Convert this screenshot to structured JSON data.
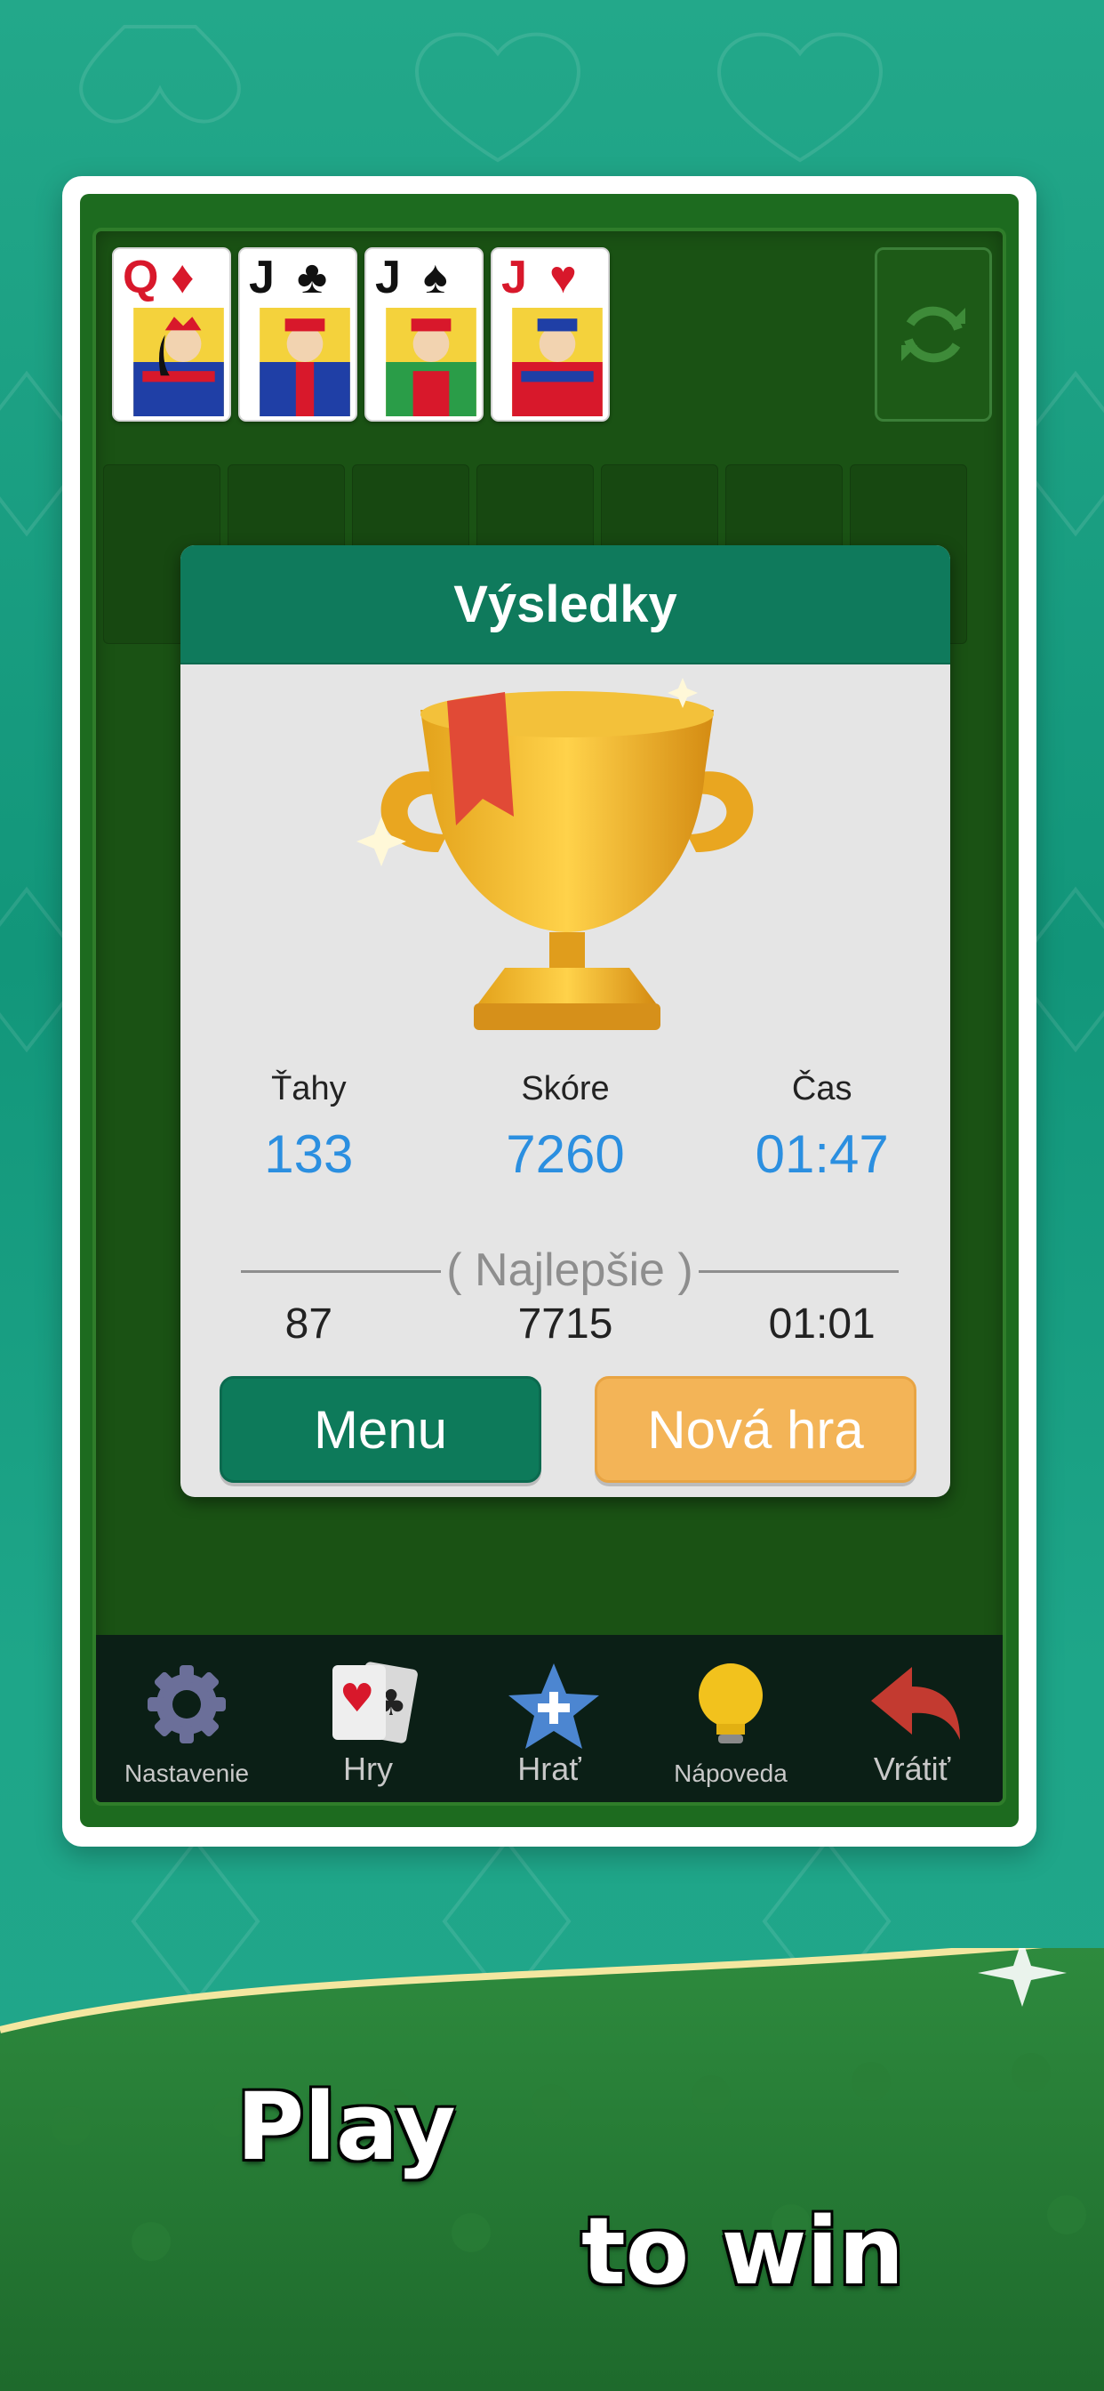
{
  "foundation": {
    "cards": [
      {
        "rank": "Q",
        "suit": "♦",
        "color": "red"
      },
      {
        "rank": "J",
        "suit": "♣",
        "color": "black"
      },
      {
        "rank": "J",
        "suit": "♠",
        "color": "black"
      },
      {
        "rank": "J",
        "suit": "♥",
        "color": "red"
      }
    ]
  },
  "refresh_icon": "refresh-icon",
  "dialog": {
    "title": "Výsledky",
    "stats": {
      "moves_label": "Ťahy",
      "score_label": "Skóre",
      "time_label": "Čas",
      "moves": "133",
      "score": "7260",
      "time": "01:47"
    },
    "best_label": "( Najlepšie )",
    "best": {
      "moves": "87",
      "score": "7715",
      "time": "01:01"
    },
    "menu_button": "Menu",
    "new_game_button": "Nová hra"
  },
  "toolbar": {
    "items": [
      {
        "label": "Nastavenie",
        "icon": "gear-icon"
      },
      {
        "label": "Hry",
        "icon": "cards-icon"
      },
      {
        "label": "Hrať",
        "icon": "star-plus-icon"
      },
      {
        "label": "Nápoveda",
        "icon": "lightbulb-icon"
      },
      {
        "label": "Vrátiť",
        "icon": "undo-arrow-icon"
      }
    ]
  },
  "banner": {
    "line1": "Play",
    "line2": "to win"
  },
  "colors": {
    "background": "#1ea689",
    "felt": "#1a5214",
    "dialog_header": "#0f7a5c",
    "stat_value": "#2b8fe0",
    "new_game": "#f3b457"
  }
}
